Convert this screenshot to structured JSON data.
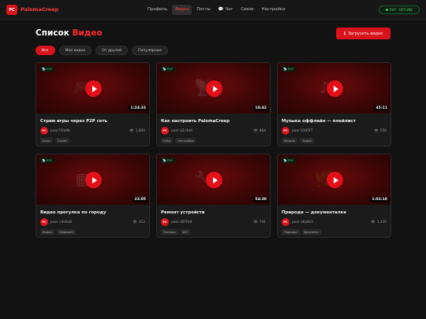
{
  "header": {
    "logo_initials": "PC",
    "app_name": "PalomaCreep",
    "nav": [
      {
        "label": "Профиль",
        "icon": "",
        "active": false
      },
      {
        "label": "Видео",
        "icon": "",
        "active": true
      },
      {
        "label": "Посты",
        "icon": "",
        "active": false
      },
      {
        "label": "Чат",
        "icon": "💬",
        "active": false
      },
      {
        "label": "Связи",
        "icon": "",
        "active": false
      },
      {
        "label": "Настройки",
        "icon": "",
        "active": false
      }
    ],
    "status": "P2P · OFFLINE"
  },
  "page": {
    "title_prefix": "Список",
    "title_accent": "Видео",
    "upload_label": "Загрузить видео"
  },
  "filters": [
    {
      "label": "Все",
      "active": true
    },
    {
      "label": "Мои видео",
      "active": false
    },
    {
      "label": "От друзей",
      "active": false
    },
    {
      "label": "Популярные",
      "active": false
    }
  ],
  "videos": [
    {
      "badge": "P2P",
      "icon": "🎮",
      "icon_name": "gamepad-icon",
      "duration": "1:24:33",
      "title": "Стрим игры через P2P сеть",
      "avatar": "PC",
      "author": "peer7f3a9b",
      "views": "1,840",
      "tags": [
        "Игры",
        "Стрим"
      ]
    },
    {
      "badge": "P2P",
      "icon": "📡",
      "icon_name": "satellite-dish-icon",
      "duration": "18:42",
      "title": "Как настроить PalomaCreep",
      "avatar": "PC",
      "author": "peer a2c4e6",
      "views": "864",
      "tags": [
        "Гайд",
        "Настройка"
      ]
    },
    {
      "badge": "P2P",
      "icon": "♪",
      "icon_name": "music-note-icon",
      "duration": "45:11",
      "title": "Музыка оффлайн — плейлист",
      "avatar": "PC",
      "author": "peer b3d5f7",
      "views": "550",
      "tags": [
        "Музыка",
        "Аудио"
      ]
    },
    {
      "badge": "P2P",
      "icon": "▦",
      "icon_name": "city-icon",
      "duration": "22:05",
      "title": "Видео прогулка по городу",
      "avatar": "PC",
      "author": "peer c4e6a8",
      "views": "312",
      "tags": [
        "Видео",
        "Оффлайн"
      ]
    },
    {
      "badge": "P2P",
      "icon": "🔧",
      "icon_name": "wrench-icon",
      "duration": "54:30",
      "title": "Ремонт устройств",
      "avatar": "PC",
      "author": "peer d5f7b9",
      "views": "741",
      "tags": [
        "Техника",
        "DIY"
      ]
    },
    {
      "badge": "P2P",
      "icon": "🌿",
      "icon_name": "leaf-icon",
      "duration": "1:02:10",
      "title": "Природа — документалка",
      "avatar": "PC",
      "author": "peer e6a8c0",
      "views": "1,330",
      "tags": [
        "Природа",
        "Документ"
      ]
    }
  ],
  "colors": {
    "accent": "#d8131b",
    "background": "#121212",
    "card": "#1b1b1b",
    "online_green": "#47d35e"
  }
}
